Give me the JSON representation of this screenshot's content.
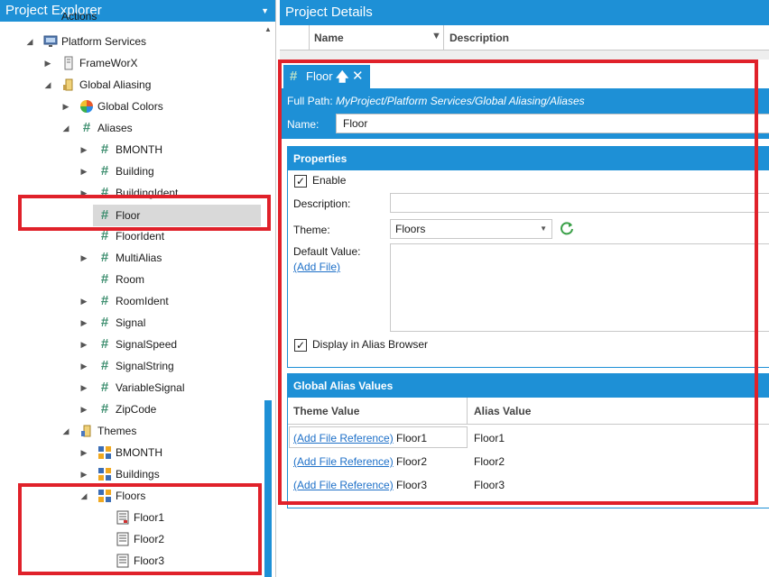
{
  "explorer": {
    "title": "Project Explorer",
    "partial_top_label": "Actions",
    "items": [
      {
        "label": "Platform Services"
      },
      {
        "label": "FrameWorX"
      },
      {
        "label": "Global Aliasing"
      },
      {
        "label": "Global Colors"
      },
      {
        "label": "Aliases"
      },
      {
        "label": "BMONTH"
      },
      {
        "label": "Building"
      },
      {
        "label": "BuildingIdent"
      },
      {
        "label": "Floor"
      },
      {
        "label": "FloorIdent"
      },
      {
        "label": "MultiAlias"
      },
      {
        "label": "Room"
      },
      {
        "label": "RoomIdent"
      },
      {
        "label": "Signal"
      },
      {
        "label": "SignalSpeed"
      },
      {
        "label": "SignalString"
      },
      {
        "label": "VariableSignal"
      },
      {
        "label": "ZipCode"
      },
      {
        "label": "Themes"
      },
      {
        "label": "BMONTH"
      },
      {
        "label": "Buildings"
      },
      {
        "label": "Floors"
      },
      {
        "label": "Floor1"
      },
      {
        "label": "Floor2"
      },
      {
        "label": "Floor3"
      }
    ]
  },
  "details": {
    "title": "Project Details",
    "grid_columns": {
      "name": "Name",
      "description": "Description"
    },
    "tab": {
      "label": "Floor"
    },
    "full_path_label": "Full Path:",
    "full_path_value": "MyProject/Platform Services/Global Aliasing/Aliases",
    "name_label": "Name:",
    "name_value": "Floor",
    "properties": {
      "header": "Properties",
      "enable_label": "Enable",
      "enable_checked": true,
      "description_label": "Description:",
      "description_value": "",
      "theme_label": "Theme:",
      "theme_value": "Floors",
      "default_value_label": "Default Value:",
      "add_file_label": "(Add File)",
      "display_in_browser_label": "Display in Alias Browser",
      "display_in_browser_checked": true
    },
    "alias_values": {
      "header": "Global Alias Values",
      "col_theme": "Theme Value",
      "col_alias": "Alias Value",
      "add_ref_label": "(Add File Reference)",
      "rows": [
        {
          "theme": "Floor1",
          "alias": "Floor1"
        },
        {
          "theme": "Floor2",
          "alias": "Floor2"
        },
        {
          "theme": "Floor3",
          "alias": "Floor3"
        }
      ]
    }
  },
  "colors": {
    "accent": "#1e90d6",
    "highlight": "#e0212a",
    "alias_icon": "#3f8f70"
  }
}
